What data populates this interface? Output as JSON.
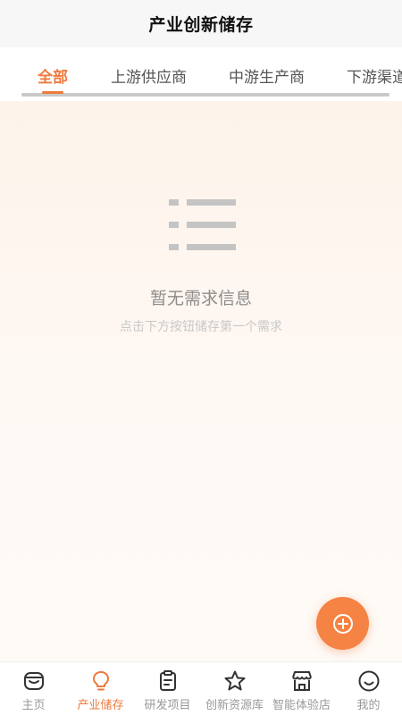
{
  "header": {
    "title": "产业创新储存"
  },
  "tabs": [
    {
      "label": "全部",
      "active": true
    },
    {
      "label": "上游供应商",
      "active": false
    },
    {
      "label": "中游生产商",
      "active": false
    },
    {
      "label": "下游渠道",
      "active": false
    }
  ],
  "empty_state": {
    "icon": "list-icon",
    "title": "暂无需求信息",
    "subtitle": "点击下方按钮储存第一个需求"
  },
  "fab": {
    "icon": "add-circle-icon"
  },
  "bottom_nav": [
    {
      "label": "主页",
      "icon": "home-face-icon",
      "active": false
    },
    {
      "label": "产业储存",
      "icon": "lightbulb-icon",
      "active": true
    },
    {
      "label": "研发项目",
      "icon": "clipboard-icon",
      "active": false
    },
    {
      "label": "创新资源库",
      "icon": "star-icon",
      "active": false
    },
    {
      "label": "智能体验店",
      "icon": "store-icon",
      "active": false
    },
    {
      "label": "我的",
      "icon": "smile-icon",
      "active": false
    }
  ],
  "colors": {
    "accent": "#ef7a3e",
    "fab": "#f58343",
    "inactive_text": "#999999"
  }
}
